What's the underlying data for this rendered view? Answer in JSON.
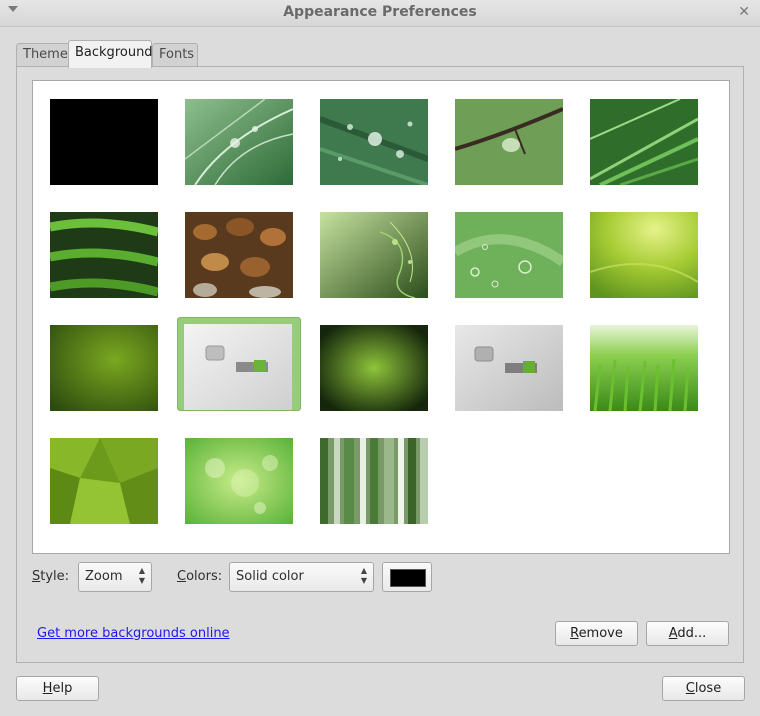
{
  "window": {
    "title": "Appearance Preferences"
  },
  "tabs": [
    {
      "label": "Theme",
      "active": false
    },
    {
      "label": "Background",
      "active": true
    },
    {
      "label": "Fonts",
      "active": false
    }
  ],
  "backgrounds": [
    {
      "name": "black"
    },
    {
      "name": "leaf-water-drops"
    },
    {
      "name": "leaf-dew"
    },
    {
      "name": "branch-droplet"
    },
    {
      "name": "grass-blades"
    },
    {
      "name": "fern"
    },
    {
      "name": "river-stones"
    },
    {
      "name": "green-swirl"
    },
    {
      "name": "green-bubbles"
    },
    {
      "name": "lime-glow"
    },
    {
      "name": "dark-green-gradient"
    },
    {
      "name": "mint-logo-light",
      "selected": true
    },
    {
      "name": "dark-green-blur"
    },
    {
      "name": "mint-logo-grey"
    },
    {
      "name": "fresh-grass"
    },
    {
      "name": "green-polygons"
    },
    {
      "name": "green-bokeh"
    },
    {
      "name": "green-stripes"
    }
  ],
  "controls": {
    "style_label_accel": "S",
    "style_label_rest": "tyle:",
    "style_value": "Zoom",
    "colors_label_accel": "C",
    "colors_label_rest": "olors:",
    "colors_value": "Solid color",
    "color_swatch": "#000000"
  },
  "link": {
    "text": "Get more backgrounds online"
  },
  "buttons": {
    "remove_accel": "R",
    "remove_rest": "emove",
    "add_accel": "A",
    "add_rest": "dd...",
    "help_accel": "H",
    "help_rest": "elp",
    "close_accel": "C",
    "close_rest": "lose"
  }
}
